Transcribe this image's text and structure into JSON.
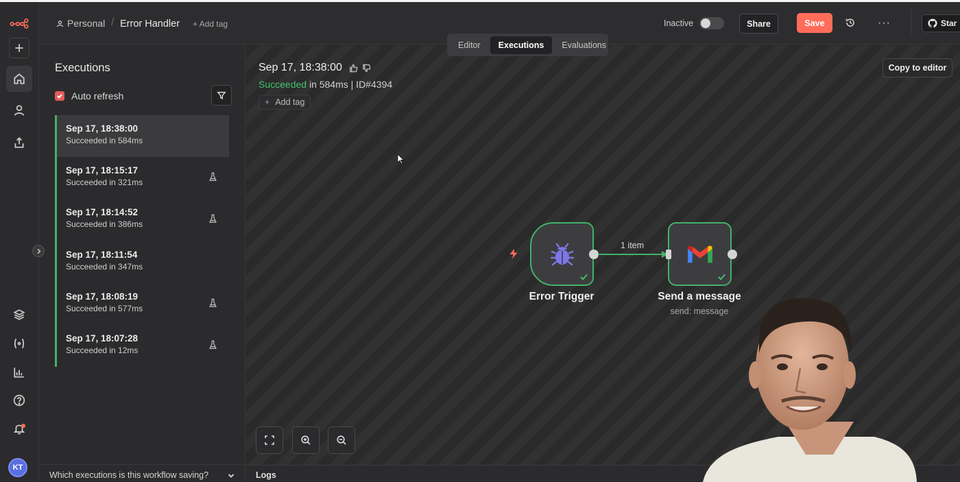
{
  "header": {
    "breadcrumb_personal": "Personal",
    "breadcrumb_sep": "/",
    "workflow_title": "Error Handler",
    "add_tag": "+ Add tag",
    "status_label": "Inactive",
    "share_label": "Share",
    "save_label": "Save",
    "more": "···",
    "star_label": "Star"
  },
  "tabs": [
    {
      "label": "Editor",
      "active": false
    },
    {
      "label": "Executions",
      "active": true
    },
    {
      "label": "Evaluations",
      "active": false
    }
  ],
  "panel": {
    "title": "Executions",
    "auto_refresh": "Auto refresh",
    "auto_refresh_checked": true,
    "footer": "Which executions is this workflow saving?",
    "executions": [
      {
        "date": "Sep 17, 18:38:00",
        "status": "Succeeded in 584ms",
        "selected": true,
        "flask": false
      },
      {
        "date": "Sep 17, 18:15:17",
        "status": "Succeeded in 321ms",
        "selected": false,
        "flask": true
      },
      {
        "date": "Sep 17, 18:14:52",
        "status": "Succeeded in 386ms",
        "selected": false,
        "flask": true
      },
      {
        "date": "Sep 17, 18:11:54",
        "status": "Succeeded in 347ms",
        "selected": false,
        "flask": false
      },
      {
        "date": "Sep 17, 18:08:19",
        "status": "Succeeded in 577ms",
        "selected": false,
        "flask": true
      },
      {
        "date": "Sep 17, 18:07:28",
        "status": "Succeeded in 12ms",
        "selected": false,
        "flask": true
      }
    ]
  },
  "execution": {
    "title": "Sep 17, 18:38:00",
    "status": "Succeeded",
    "meta": " in 584ms | ID#4394",
    "add_tag": "Add tag",
    "copy_label": "Copy to editor"
  },
  "workflow": {
    "nodes": [
      {
        "name": "Error Trigger",
        "icon": "bug-icon"
      },
      {
        "name": "Send a message",
        "subtitle": "send: message",
        "icon": "gmail-icon"
      }
    ],
    "edge_label": "1 item"
  },
  "logs_label": "Logs",
  "avatar_initials": "KT",
  "colors": {
    "accent": "#ff6d5a",
    "success": "#43b26b",
    "bg": "#2a2a2a"
  }
}
